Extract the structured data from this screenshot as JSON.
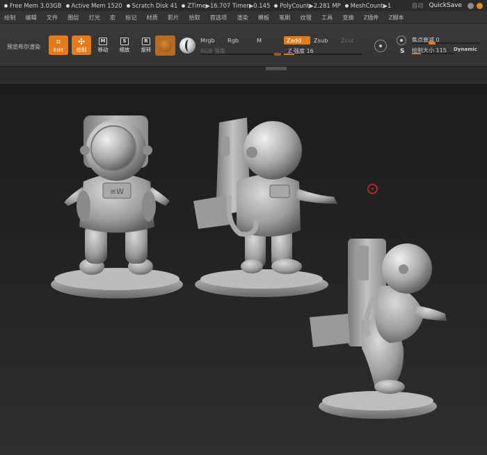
{
  "status_bar": {
    "stats": [
      "Free Mem 3.03GB",
      "Active Mem 1520",
      "Scratch Disk 41",
      "ZTime▶16.707 Timer▶0.145",
      "PolyCount▶2.281 MP",
      "MeshCount▶1"
    ],
    "autosave_label": "自动",
    "quicksave_label": "QuickSave"
  },
  "menu": {
    "items": [
      "绘制",
      "编辑",
      "文件",
      "图层",
      "灯光",
      "宏",
      "标记",
      "材质",
      "影片",
      "拾取",
      "首选项",
      "渲染",
      "模板",
      "笔刷",
      "纹理",
      "工具",
      "变换",
      "Z插件",
      "Z脚本"
    ]
  },
  "shelf": {
    "preview_label": "预览布尔渲染",
    "edit_label": "Edit",
    "draw_label": "绘制",
    "move_label": "移动",
    "scale_label": "缩放",
    "rotate_label": "旋转",
    "move_glyph": "M",
    "scale_glyph": "S",
    "rotate_glyph": "R",
    "mrgb_label": "Mrgb",
    "rgb_label": "Rgb",
    "m_label": "M",
    "zadd_label": "Zadd",
    "zsub_label": "Zsub",
    "zcut_label": "Zcut",
    "rgb_intensity_label": "RGB 强度",
    "z_intensity_label": "Z 强度 16",
    "z_intensity_value": 16,
    "focal_shift_label": "焦点衰减 0",
    "draw_size_label": "绘制大小 115",
    "draw_size_value": 115,
    "dynamic_label": "Dynamic",
    "s_label": "S"
  }
}
